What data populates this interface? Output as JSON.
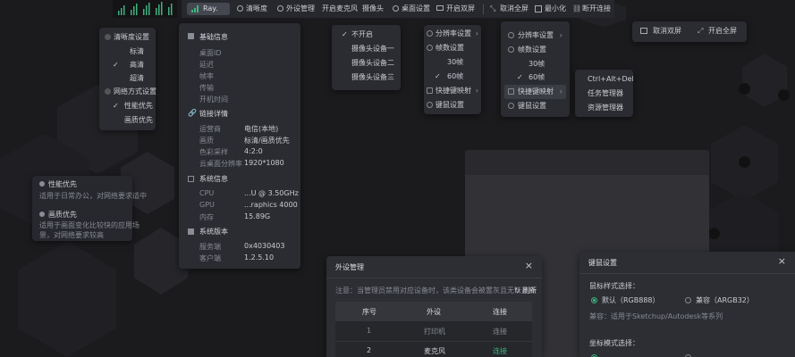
{
  "toolbar": {
    "items": [
      "清晰度",
      "外设管理",
      "开启麦克风",
      "摄像头",
      "桌面设置",
      "开启双屏",
      "取消全屏",
      "最小化",
      "断开连接"
    ],
    "ray_label": "Ray."
  },
  "clarity_menu": {
    "header": "清晰度设置",
    "options": [
      "标清",
      "高清",
      "超清"
    ],
    "selected": "高清",
    "network_header": "网络方式设置",
    "network_options": [
      "性能优先",
      "画质优先"
    ],
    "network_selected": "性能优先"
  },
  "tooltip": {
    "perf_title": "性能优先",
    "perf_desc": "适用于日常办公，对网络要求适中",
    "quality_title": "画质优先",
    "quality_desc_1": "适用于画面变化比较快的应用场",
    "quality_desc_2": "景，对网络要求较高"
  },
  "info_panel": {
    "basic_title": "基础信息",
    "basic_labels": [
      "桌面ID",
      "延迟",
      "帧率",
      "传输",
      "开机时间"
    ],
    "link_title": "链接详情",
    "link_rows": [
      [
        "运营商",
        "电信(本地)"
      ],
      [
        "画质",
        "标清/画质优先"
      ],
      [
        "色彩采样",
        "4:2:0"
      ],
      [
        "云桌面分辨率",
        "1920*1080"
      ]
    ],
    "sys_title": "系统信息",
    "sys_rows": [
      [
        "CPU",
        "...U @ 3.50GHz"
      ],
      [
        "GPU",
        "...raphics 4000"
      ],
      [
        "内存",
        "15.89G"
      ]
    ],
    "ver_title": "系统版本",
    "ver_rows": [
      [
        "服务端",
        "0x4030403"
      ],
      [
        "客户端",
        "1.2.5.10"
      ]
    ]
  },
  "camera_menu": {
    "items": [
      "不开启",
      "摄像头设备一",
      "摄像头设备二",
      "摄像头设备三"
    ],
    "selected": "不开启"
  },
  "desktop_menu_1": {
    "items": [
      "分辨率设置",
      "帧数设置",
      "30帧",
      "60帧",
      "快捷键映射",
      "键鼠设置"
    ],
    "selected": "60帧"
  },
  "desktop_menu_2": {
    "items": [
      "分辨率设置",
      "帧数设置",
      "30帧",
      "60帧",
      "快捷键映射",
      "键鼠设置"
    ],
    "selected": "60帧"
  },
  "shortcut_menu": {
    "items": [
      "Ctrl+Alt+Del",
      "任务管理器",
      "资源管理器"
    ]
  },
  "dual_screen": {
    "cancel": "取消双屏",
    "fullscreen": "开启全屏"
  },
  "peripheral_dialog": {
    "title": "外设管理",
    "notice": "注意：当管理员禁用对应设备时，该类设备会被置灰且无法选择",
    "refresh": "刷新",
    "columns": [
      "序号",
      "外设",
      "连接"
    ],
    "rows": [
      [
        "1",
        "打印机",
        "连接"
      ],
      [
        "2",
        "麦克风",
        "连接"
      ]
    ]
  },
  "kbm_dialog": {
    "title": "键鼠设置",
    "kb_label": "鼠标样式选择：",
    "opt_default": "默认（RGB888）",
    "opt_compat": "兼容（ARGB32）",
    "note": "兼容：适用于Sketchup/Autodesk等系列",
    "coord_label": "坐标模式选择："
  }
}
